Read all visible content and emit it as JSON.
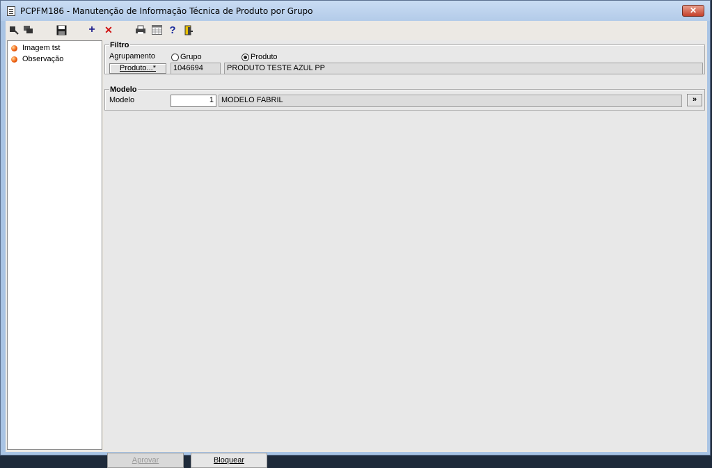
{
  "window": {
    "title": "PCPFM186 - Manutenção de Informação Técnica de Produto por Grupo",
    "close_symbol": "✕"
  },
  "toolbar": {
    "buttons": [
      {
        "icon": "first-record-icon"
      },
      {
        "icon": "copy-record-icon"
      },
      {
        "icon": "save-icon"
      },
      {
        "icon": "add-icon",
        "glyph": "+"
      },
      {
        "icon": "delete-icon",
        "glyph": "✕"
      },
      {
        "icon": "print-icon"
      },
      {
        "icon": "calendar-icon"
      },
      {
        "icon": "help-icon",
        "glyph": "?"
      },
      {
        "icon": "exit-icon"
      }
    ]
  },
  "sidebar": {
    "items": [
      {
        "label": "Imagem tst"
      },
      {
        "label": "Observação"
      }
    ]
  },
  "filtro": {
    "title": "Filtro",
    "agrupamento_label": "Agrupamento",
    "options": [
      {
        "label": "Grupo",
        "selected": false
      },
      {
        "label": "Produto",
        "selected": true
      }
    ],
    "produto_button": "Produto...*",
    "produto_code": "1046694",
    "produto_desc": "PRODUTO TESTE AZUL PP"
  },
  "modelo": {
    "title": "Modelo",
    "label": "Modelo",
    "value": "1",
    "desc": "MODELO FABRIL",
    "lookup_button": "»"
  },
  "actions": {
    "aprovar": "Aprovar",
    "bloquear": "Bloquear"
  },
  "colors": {
    "title_bg": "#b9cfea",
    "panel_bg": "#e8e8e8",
    "close_red": "#c5402a",
    "bullet_orange": "#f06010"
  }
}
